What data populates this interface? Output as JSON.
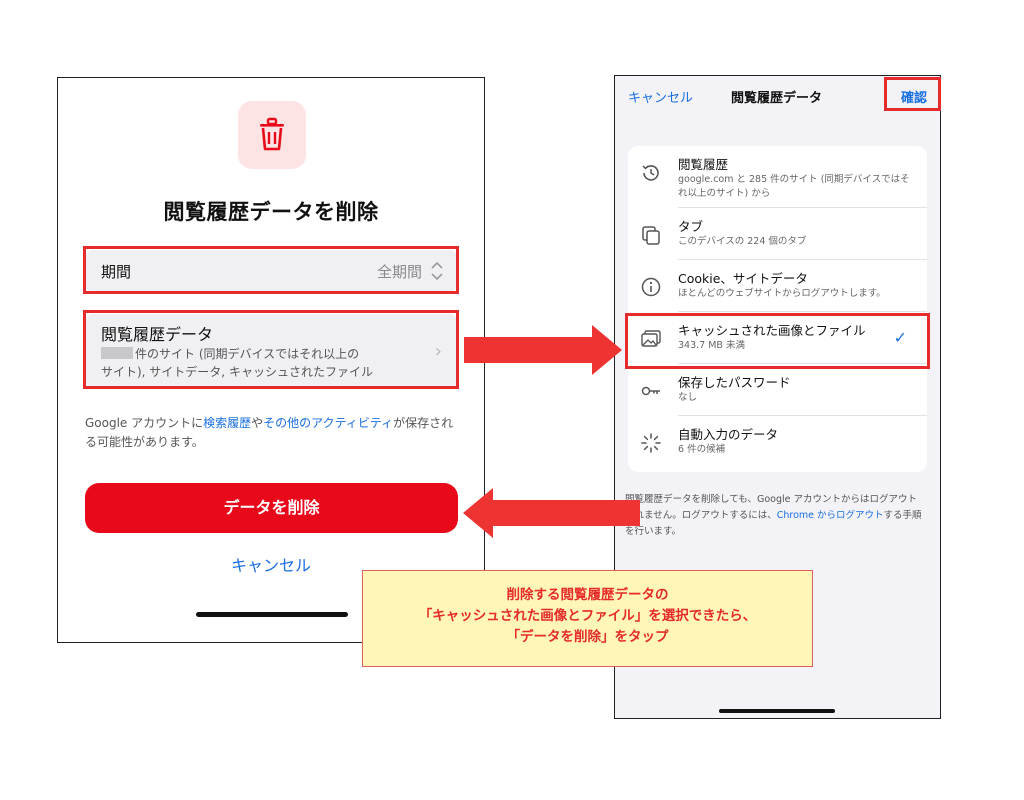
{
  "left_screen": {
    "title": "閲覧履歴データを削除",
    "period": {
      "label": "期間",
      "value": "全期間"
    },
    "history": {
      "label": "閲覧履歴データ",
      "desc_line1": "件のサイト (同期デバイスではそれ以上の",
      "desc_line2": "サイト), サイトデータ, キャッシュされたファイル"
    },
    "note": {
      "part1": "Google アカウントに",
      "link1": "検索履歴",
      "part2": "や",
      "link2": "その他のアクティビティ",
      "part3": "が保存される可能性があります。"
    },
    "delete_button": "データを削除",
    "cancel": "キャンセル"
  },
  "right_screen": {
    "nav": {
      "cancel": "キャンセル",
      "title": "閲覧履歴データ",
      "confirm": "確認"
    },
    "items": [
      {
        "title": "閲覧履歴",
        "desc": "google.com と 285 件のサイト (同期デバイスではそれ以上のサイト) から",
        "icon": "history-icon"
      },
      {
        "title": "タブ",
        "desc": "このデバイスの 224 個のタブ",
        "icon": "tabs-icon"
      },
      {
        "title": "Cookie、サイトデータ",
        "desc": "ほとんどのウェブサイトからログアウトします。",
        "icon": "info-icon"
      },
      {
        "title": "キャッシュされた画像とファイル",
        "desc": "343.7 MB 未満",
        "icon": "image-icon",
        "selected": true
      },
      {
        "title": "保存したパスワード",
        "desc": "なし",
        "icon": "key-icon"
      },
      {
        "title": "自動入力のデータ",
        "desc": "6 件の候補",
        "icon": "autofill-icon"
      }
    ],
    "note": {
      "part1": "閲覧履歴データを削除しても、Google アカウントからはログアウトされません。ログアウトするには、",
      "link": "Chrome からログアウト",
      "part2": "する手順を行います。"
    }
  },
  "callout": {
    "line1": "削除する閲覧履歴データの",
    "line2": "「キャッシュされた画像とファイル」を選択できたら、",
    "line3": "「データを削除」をタップ"
  },
  "colors": {
    "accent_red": "#e8091a",
    "highlight_red": "#e52b2b",
    "link_blue": "#1a6fe0",
    "callout_bg": "#fff6b8"
  }
}
